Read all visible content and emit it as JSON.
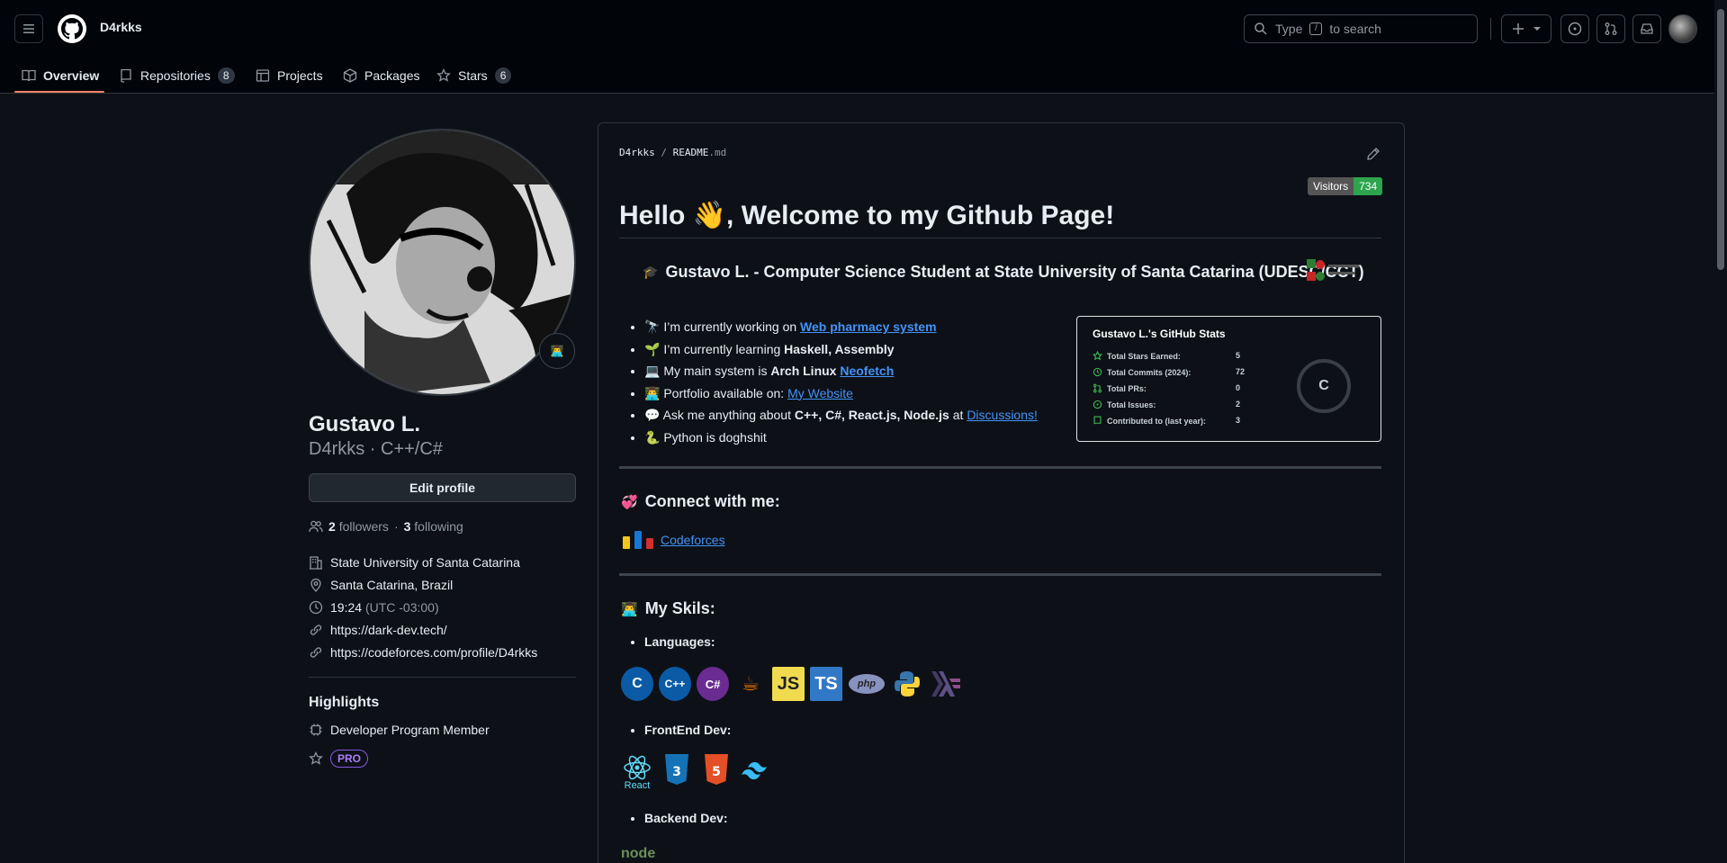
{
  "header": {
    "username": "D4rkks",
    "search": {
      "prefix": "Type",
      "key": "/",
      "suffix": "to search"
    }
  },
  "tabs": [
    {
      "label": "Overview"
    },
    {
      "label": "Repositories",
      "count": "8"
    },
    {
      "label": "Projects"
    },
    {
      "label": "Packages"
    },
    {
      "label": "Stars",
      "count": "6"
    }
  ],
  "profile": {
    "name": "Gustavo L.",
    "handle": "D4rkks · C++/C#",
    "edit_label": "Edit profile",
    "followers_count": "2",
    "followers_label": "followers",
    "following_count": "3",
    "following_label": "following",
    "dot": "·",
    "org": "State University of Santa Catarina",
    "location": "Santa Catarina, Brazil",
    "time": "19:24",
    "tz": "(UTC -03:00)",
    "link1": "https://dark-dev.tech/",
    "link2": "https://codeforces.com/profile/D4rkks",
    "highlights_title": "Highlights",
    "highlight1": "Developer Program Member",
    "pro_badge": "PRO"
  },
  "readme": {
    "crumb_user": "D4rkks",
    "crumb_sep": "/",
    "crumb_file": "README",
    "crumb_ext": ".md",
    "visitors_label": "Visitors",
    "visitors_count": "734",
    "title": "Hello 👋, Welcome to my Github Page!",
    "subtitle": "Gustavo L. - Computer Science Student at State University of Santa Catarina (UDESC/CCT)",
    "list": [
      {
        "emoji": "🔭",
        "pre": "I’m currently working on ",
        "link": "Web pharmacy system"
      },
      {
        "emoji": "🌱",
        "pre": "I’m currently learning ",
        "bold": "Haskell, Assembly"
      },
      {
        "emoji": "💻",
        "pre": "My main system is ",
        "bold": "Arch Linux",
        "link": "Neofetch"
      },
      {
        "emoji": "👨‍💻",
        "pre": "Portfolio available on: ",
        "link": "My Website"
      },
      {
        "emoji": "💬",
        "pre": "Ask me anything about ",
        "bold": "C++, C#, React.js, Node.js",
        "mid": " at ",
        "link": "Discussions!"
      },
      {
        "emoji": "🐍",
        "pre": "Python is doghshit"
      }
    ],
    "connect_title": "Connect with me:",
    "codeforces": "Codeforces",
    "skills_title": "My Skils:",
    "languages_label": "Languages:",
    "frontend_label": "FrontEnd Dev:",
    "backend_label": "Backend Dev:",
    "languages": [
      "C",
      "C++",
      "C#",
      "Java",
      "JS",
      "TS",
      "php",
      "Python",
      "Haskell"
    ],
    "frontend": [
      "React",
      "CSS3",
      "HTML5",
      "Tailwind"
    ],
    "backend_partial": "node"
  },
  "stats": {
    "title": "Gustavo L.'s GitHub Stats",
    "rows": [
      {
        "label": "Total Stars Earned:",
        "value": "5"
      },
      {
        "label": "Total Commits (2024):",
        "value": "72"
      },
      {
        "label": "Total PRs:",
        "value": "0"
      },
      {
        "label": "Total Issues:",
        "value": "2"
      },
      {
        "label": "Contributed to (last year):",
        "value": "3"
      }
    ],
    "grade": "C"
  }
}
